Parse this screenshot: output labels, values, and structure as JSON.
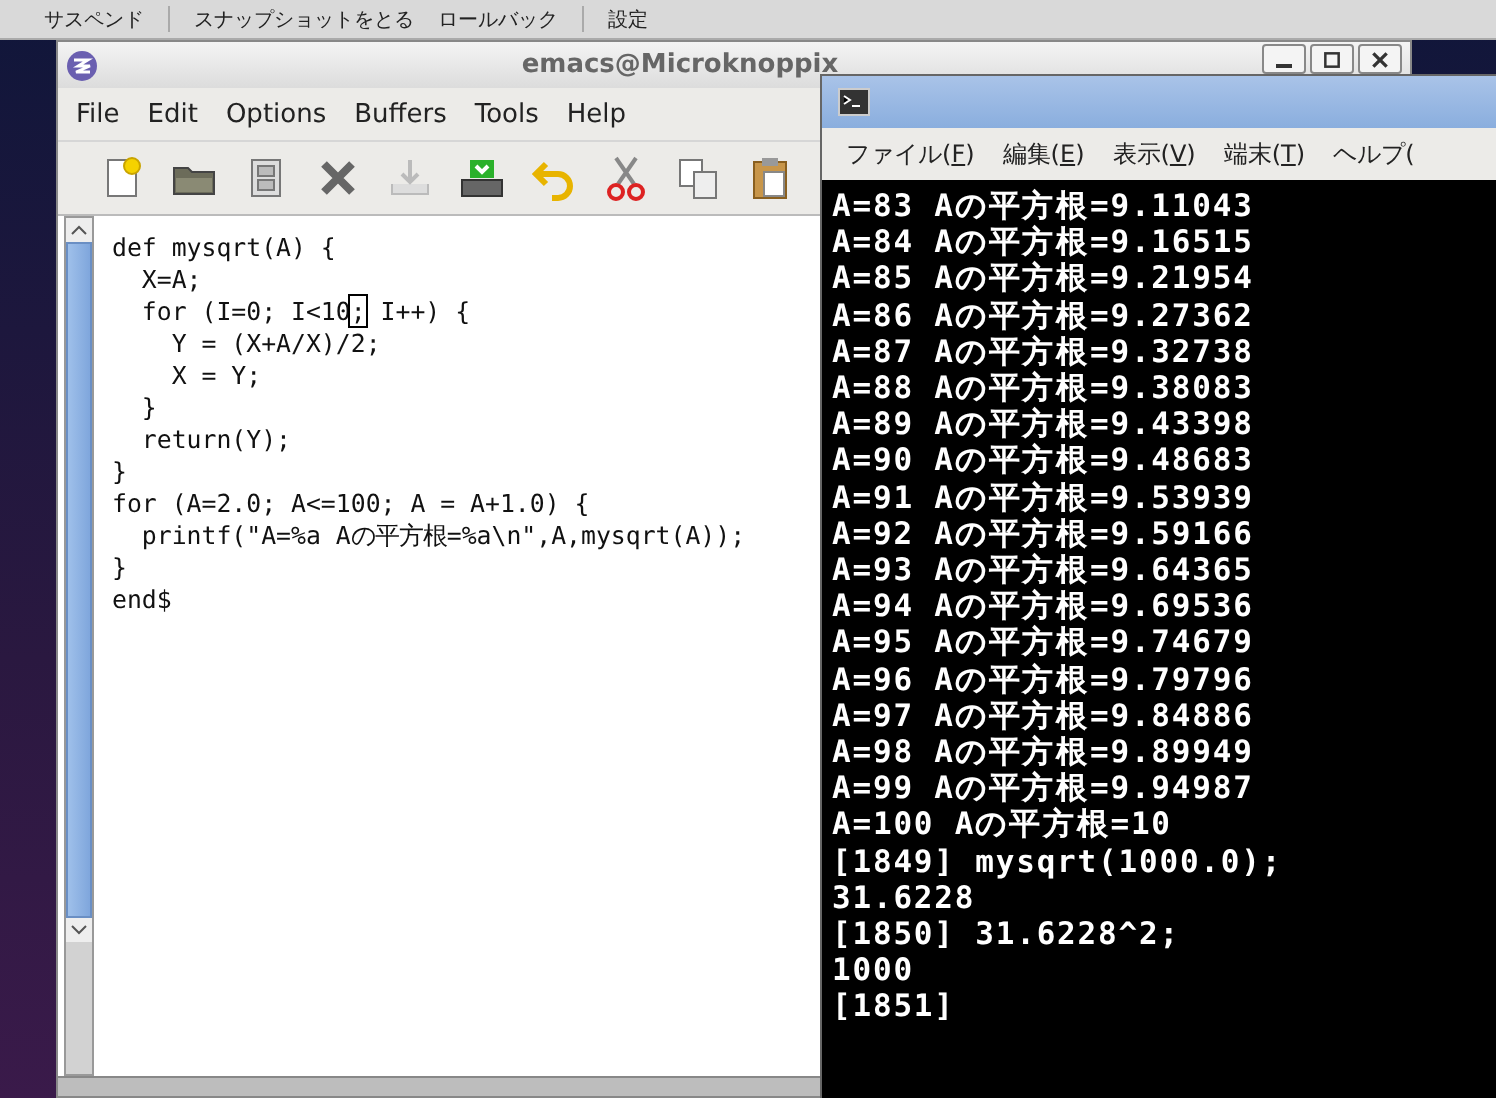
{
  "top_panel": {
    "items": [
      "サスペンド",
      "スナップショットをとる",
      "ロールバック",
      "設定"
    ]
  },
  "emacs": {
    "title": "emacs@Microknoppix",
    "menu": [
      "File",
      "Edit",
      "Options",
      "Buffers",
      "Tools",
      "Help"
    ],
    "code_lines": [
      {
        "text": "def mysqrt(A) {"
      },
      {
        "text": "  X=A;"
      },
      {
        "text": "  for (I=0; I<10",
        "cursor": ";",
        "after": " I++) {"
      },
      {
        "text": "    Y = (X+A/X)/2;"
      },
      {
        "text": "    X = Y;"
      },
      {
        "text": "  }"
      },
      {
        "text": "  return(Y);"
      },
      {
        "text": "}"
      },
      {
        "text": "for (A=2.0; A<=100; A = A+1.0) {"
      },
      {
        "text": "  printf(\"A=%a Aの平方根=%a\\n\",A,mysqrt(A));"
      },
      {
        "text": "}"
      },
      {
        "text": "end$"
      }
    ]
  },
  "terminal": {
    "menu": [
      {
        "before": "ファイル(",
        "key": "F",
        "after": ")"
      },
      {
        "before": "編集(",
        "key": "E",
        "after": ")"
      },
      {
        "before": "表示(",
        "key": "V",
        "after": ")"
      },
      {
        "before": "端末(",
        "key": "T",
        "after": ")"
      },
      {
        "before": "ヘルプ("
      }
    ],
    "lines": [
      "A=83 Aの平方根=9.11043",
      "A=84 Aの平方根=9.16515",
      "A=85 Aの平方根=9.21954",
      "A=86 Aの平方根=9.27362",
      "A=87 Aの平方根=9.32738",
      "A=88 Aの平方根=9.38083",
      "A=89 Aの平方根=9.43398",
      "A=90 Aの平方根=9.48683",
      "A=91 Aの平方根=9.53939",
      "A=92 Aの平方根=9.59166",
      "A=93 Aの平方根=9.64365",
      "A=94 Aの平方根=9.69536",
      "A=95 Aの平方根=9.74679",
      "A=96 Aの平方根=9.79796",
      "A=97 Aの平方根=9.84886",
      "A=98 Aの平方根=9.89949",
      "A=99 Aの平方根=9.94987",
      "A=100 Aの平方根=10",
      "[1849] mysqrt(1000.0);",
      "31.6228",
      "[1850] 31.6228^2;",
      "1000",
      "[1851]"
    ]
  }
}
